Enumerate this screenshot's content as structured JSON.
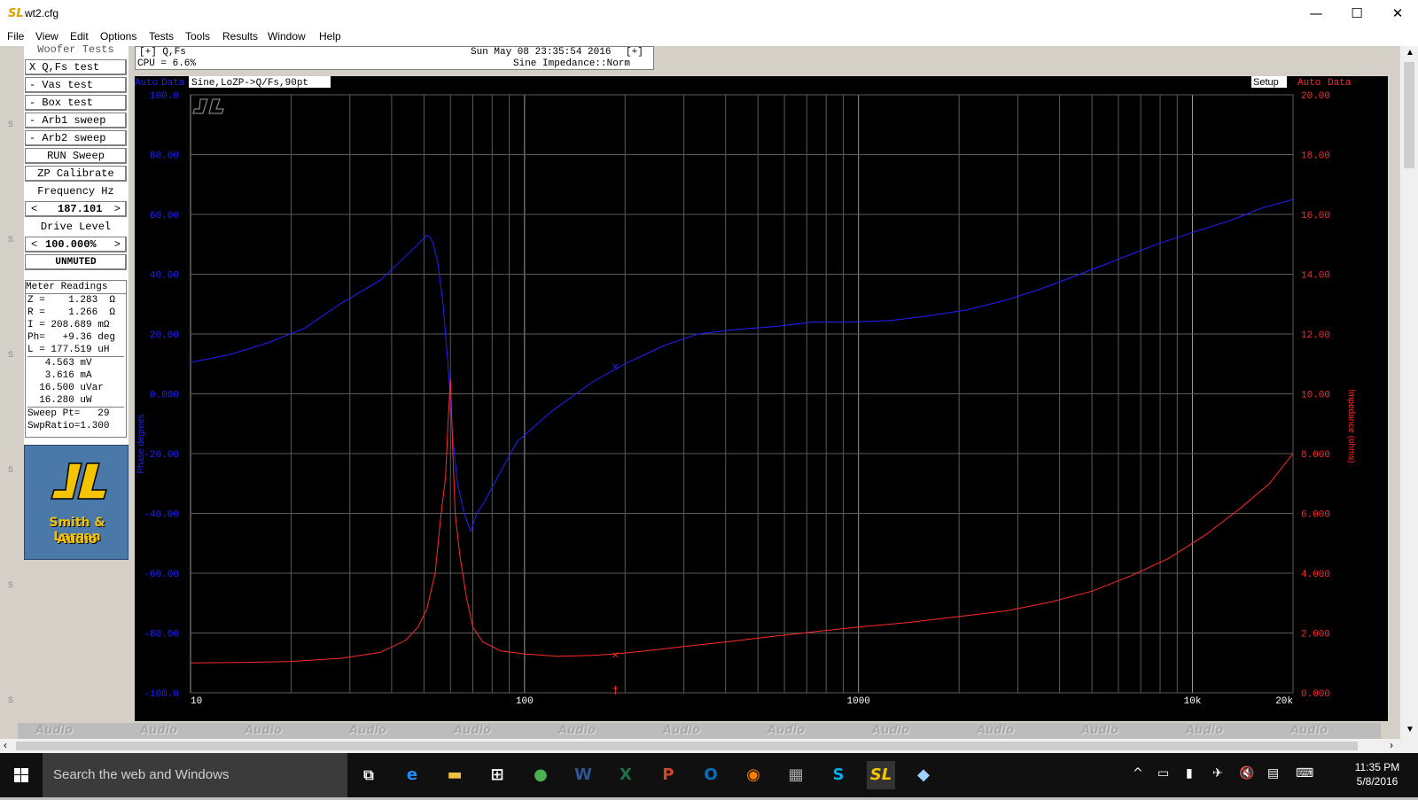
{
  "window": {
    "title": "wt2.cfg",
    "app_icon": "SL",
    "controls": {
      "minimize": "—",
      "maximize": "☐",
      "close": "✕"
    }
  },
  "menu": [
    "File",
    "View",
    "Edit",
    "Options",
    "Tests",
    "Tools",
    "Results",
    "Window",
    "Help"
  ],
  "left_panel": {
    "header": "Woofer Tests",
    "buttons": [
      "X Q,Fs test",
      "- Vas test",
      "- Box test",
      "- Arb1 sweep",
      "- Arb2 sweep",
      "RUN Sweep",
      "ZP Calibrate"
    ],
    "freq_label": "Frequency Hz",
    "freq_dec": "<",
    "freq_value": "187.101",
    "freq_inc": ">",
    "drive_label": "Drive Level",
    "drive_dec": "<",
    "drive_value": "100.000%",
    "drive_inc": ">",
    "mute": "UNMUTED"
  },
  "meter": {
    "title": "Meter Readings",
    "lines": [
      "Z =    1.283  Ω",
      "R =    1.266  Ω",
      "I = 208.689 mΩ",
      "Ph=   +9.36 deg",
      "L = 177.519 uH",
      "   4.563 mV",
      "   3.616 mA",
      "  16.500 uVar",
      "  16.280 uW",
      "Sweep Pt=   29",
      "SwpRatio=1.300"
    ]
  },
  "logo": {
    "line1": "Smith & Larson",
    "line2": "Audio"
  },
  "status": {
    "left1": "[+] Q,Fs",
    "datetime": "Sun May 08 23:35:54 2016",
    "right1": "[+]",
    "cpu": "CPU = 6.6%",
    "mode": "Sine Impedance::Norm"
  },
  "graph": {
    "left_auto": "Auto",
    "left_data": "Data",
    "title": "Sine,LoZP->Q/Fs,90pt",
    "setup": "Setup",
    "right_auto": "Auto",
    "right_data": "Data",
    "left_axis_label": "Phase degrees",
    "right_axis_label": "Impedance (ohms)",
    "left_color": "#2020ff",
    "right_color": "#ff2a2a"
  },
  "chart_data": {
    "type": "line",
    "x_scale": "log",
    "xlim": [
      10,
      20000
    ],
    "x_ticks": [
      {
        "value": 10,
        "label": "10"
      },
      {
        "value": 100,
        "label": "100"
      },
      {
        "value": 1000,
        "label": "1000"
      },
      {
        "value": 10000,
        "label": "10k"
      },
      {
        "value": 20000,
        "label": "20k"
      }
    ],
    "y_left": {
      "label": "Phase degrees",
      "ylim": [
        -100,
        100
      ],
      "ticks": [
        "100.0",
        "80.00",
        "60.00",
        "40.00",
        "20.00",
        "0.000",
        "-20.00",
        "-40.00",
        "-60.00",
        "-80.00",
        "-100.0"
      ]
    },
    "y_right": {
      "label": "Impedance (ohms)",
      "ylim": [
        0,
        20
      ],
      "ticks": [
        "20.00",
        "18.00",
        "16.00",
        "14.00",
        "12.00",
        "10.00",
        "8.000",
        "6.000",
        "4.000",
        "2.000",
        "0.000"
      ]
    },
    "grid": true,
    "series": [
      {
        "axis": "left",
        "color": "#2020ff",
        "x": [
          10,
          13,
          17,
          22,
          28,
          37,
          44,
          48,
          50,
          51,
          52,
          53,
          55,
          57,
          59,
          61,
          63,
          66,
          69,
          72,
          76,
          82,
          95,
          120,
          160,
          200,
          260,
          330,
          430,
          560,
          730,
          950,
          1250,
          1600,
          2100,
          2700,
          3500,
          4600,
          6000,
          7800,
          10000,
          13000,
          16000,
          20000
        ],
        "y": [
          10.5,
          13,
          17,
          22,
          30,
          38,
          46,
          50,
          52,
          53,
          52.5,
          51,
          44,
          30,
          10,
          -15,
          -30,
          -40,
          -46,
          -40,
          -36,
          -29,
          -16,
          -6,
          4,
          10,
          16,
          20,
          21.5,
          22.5,
          24,
          24,
          24.5,
          26,
          28,
          31,
          35,
          40,
          45,
          50,
          54,
          58,
          62,
          65
        ]
      },
      {
        "axis": "right",
        "color": "#ff2a2a",
        "x": [
          10,
          15,
          20,
          28,
          37,
          44,
          48,
          51,
          54,
          56,
          58,
          59,
          60,
          61,
          62,
          64,
          67,
          70,
          75,
          85,
          100,
          125,
          160,
          187,
          230,
          300,
          400,
          550,
          750,
          1000,
          1400,
          2000,
          2800,
          3800,
          5000,
          6500,
          8500,
          11000,
          14000,
          17000,
          20000
        ],
        "y": [
          1.0,
          1.02,
          1.05,
          1.15,
          1.35,
          1.75,
          2.2,
          2.8,
          4.0,
          5.8,
          7.2,
          9.0,
          10.5,
          8.0,
          6.0,
          4.6,
          3.2,
          2.2,
          1.7,
          1.4,
          1.3,
          1.22,
          1.25,
          1.3,
          1.4,
          1.55,
          1.7,
          1.88,
          2.05,
          2.2,
          2.35,
          2.55,
          2.75,
          3.05,
          3.4,
          3.9,
          4.5,
          5.3,
          6.2,
          7.0,
          8.0
        ]
      }
    ],
    "markers": [
      {
        "axis": "left",
        "x": 187.101,
        "y": 9.36,
        "symbol": "×"
      },
      {
        "axis": "right",
        "x": 187.101,
        "y": 1.283,
        "symbol": "×"
      }
    ]
  },
  "bottom_strip_text": "Audio",
  "taskbar": {
    "search": "Search the web and Windows",
    "time": "11:35 PM",
    "date": "5/8/2016"
  }
}
